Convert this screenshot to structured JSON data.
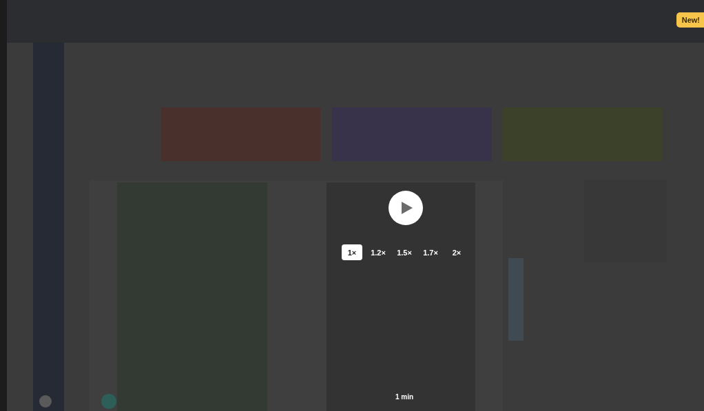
{
  "badge": {
    "label": "New!"
  },
  "player": {
    "speeds": [
      {
        "label": "1×",
        "selected": true
      },
      {
        "label": "1.2×",
        "selected": false
      },
      {
        "label": "1.5×",
        "selected": false
      },
      {
        "label": "1.7×",
        "selected": false
      },
      {
        "label": "2×",
        "selected": false
      }
    ],
    "duration": "1 min"
  }
}
